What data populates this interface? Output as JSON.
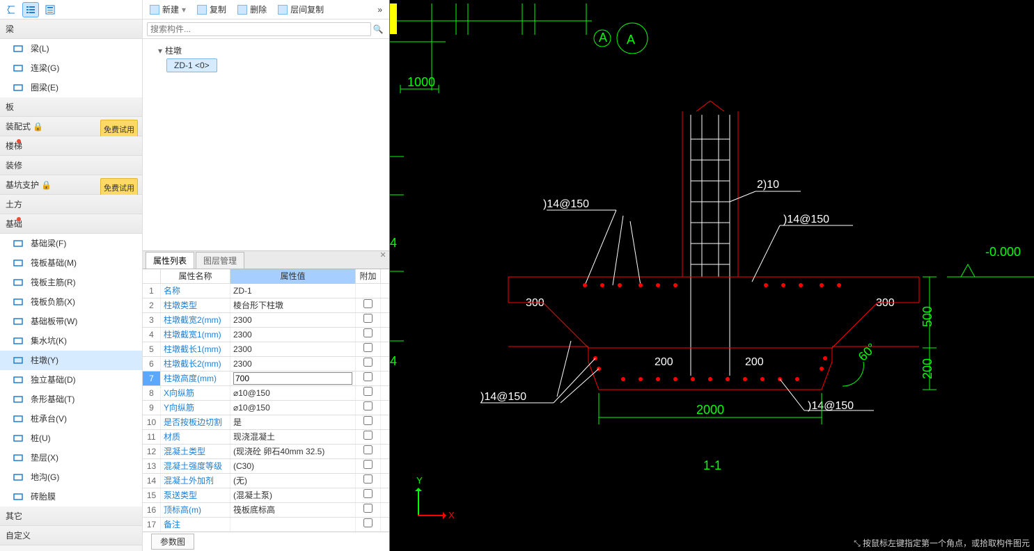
{
  "sidebar": {
    "groups": [
      {
        "label": "梁",
        "badge": null,
        "dot": false,
        "items": [
          {
            "label": "梁(L)",
            "icon": "beam"
          },
          {
            "label": "连梁(G)",
            "icon": "link-beam"
          },
          {
            "label": "圈梁(E)",
            "icon": "ring-beam"
          }
        ]
      },
      {
        "label": "板",
        "badge": null,
        "dot": false,
        "items": []
      },
      {
        "label": "装配式",
        "badge": "免费试用",
        "dot": false,
        "lock": true,
        "items": []
      },
      {
        "label": "楼梯",
        "badge": null,
        "dot": true,
        "items": []
      },
      {
        "label": "装修",
        "badge": null,
        "dot": false,
        "items": []
      },
      {
        "label": "基坑支护",
        "badge": "免费试用",
        "dot": false,
        "lock": true,
        "items": []
      },
      {
        "label": "土方",
        "badge": null,
        "dot": false,
        "items": []
      },
      {
        "label": "基础",
        "badge": null,
        "dot": true,
        "items": [
          {
            "label": "基础梁(F)",
            "icon": "found-beam"
          },
          {
            "label": "筏板基础(M)",
            "icon": "raft"
          },
          {
            "label": "筏板主筋(R)",
            "icon": "raft-main"
          },
          {
            "label": "筏板负筋(X)",
            "icon": "raft-neg"
          },
          {
            "label": "基础板带(W)",
            "icon": "strip"
          },
          {
            "label": "集水坑(K)",
            "icon": "sump"
          },
          {
            "label": "柱墩(Y)",
            "icon": "pier",
            "selected": true
          },
          {
            "label": "独立基础(D)",
            "icon": "iso-found"
          },
          {
            "label": "条形基础(T)",
            "icon": "strip-found"
          },
          {
            "label": "桩承台(V)",
            "icon": "pile-cap"
          },
          {
            "label": "桩(U)",
            "icon": "pile"
          },
          {
            "label": "垫层(X)",
            "icon": "bedding"
          },
          {
            "label": "地沟(G)",
            "icon": "trench"
          },
          {
            "label": "砖胎膜",
            "icon": "brick-mold"
          }
        ]
      },
      {
        "label": "其它",
        "badge": null,
        "dot": false,
        "items": []
      },
      {
        "label": "自定义",
        "badge": null,
        "dot": false,
        "items": []
      }
    ]
  },
  "mid_toolbar": {
    "new": "新建",
    "copy": "复制",
    "delete": "删除",
    "layer_copy": "层间复制",
    "more": "»"
  },
  "search_placeholder": "搜索构件...",
  "tree": {
    "root": "柱墩",
    "child": "ZD-1 <0>"
  },
  "tabs": {
    "prop": "属性列表",
    "layer": "图层管理"
  },
  "prop_head": {
    "name": "属性名称",
    "value": "属性值",
    "extra": "附加"
  },
  "properties": [
    {
      "n": "名称",
      "v": "ZD-1"
    },
    {
      "n": "柱墩类型",
      "v": "棱台形下柱墩"
    },
    {
      "n": "柱墩截宽2(mm)",
      "v": "2300"
    },
    {
      "n": "柱墩截宽1(mm)",
      "v": "2300"
    },
    {
      "n": "柱墩截长1(mm)",
      "v": "2300"
    },
    {
      "n": "柱墩截长2(mm)",
      "v": "2300"
    },
    {
      "n": "柱墩高度(mm)",
      "v": "700",
      "edit": true
    },
    {
      "n": "X向纵筋",
      "v": "⌀10@150"
    },
    {
      "n": "Y向纵筋",
      "v": "⌀10@150"
    },
    {
      "n": "是否按板边切割",
      "v": "是"
    },
    {
      "n": "材质",
      "v": "现浇混凝土"
    },
    {
      "n": "混凝土类型",
      "v": "(现浇砼 卵石40mm 32.5)"
    },
    {
      "n": "混凝土强度等级",
      "v": "(C30)"
    },
    {
      "n": "混凝土外加剂",
      "v": "(无)"
    },
    {
      "n": "泵送类型",
      "v": "(混凝土泵)"
    },
    {
      "n": "顶标高(m)",
      "v": "筏板底标高"
    },
    {
      "n": "备注",
      "v": ""
    }
  ],
  "param_btn": "参数图",
  "canvas": {
    "dim_1000": "1000",
    "grid_A": "A",
    "rebar1": ")14@150",
    "rebar2": "2)10",
    "rebar3": ")14@150",
    "rebar4": ")14@150",
    "rebar5": ")14@150",
    "n300a": "300",
    "n300b": "300",
    "n200a": "200",
    "n200b": "200",
    "n2000": "2000",
    "n500": "500",
    "n200v": "200",
    "angle": "60°",
    "elev": "-0.000",
    "section": "1-1",
    "fournum": "4",
    "axis_x": "X",
    "axis_y": "Y"
  },
  "status": "⤡ 按鼠标左键指定第一个角点，或拾取构件图元"
}
